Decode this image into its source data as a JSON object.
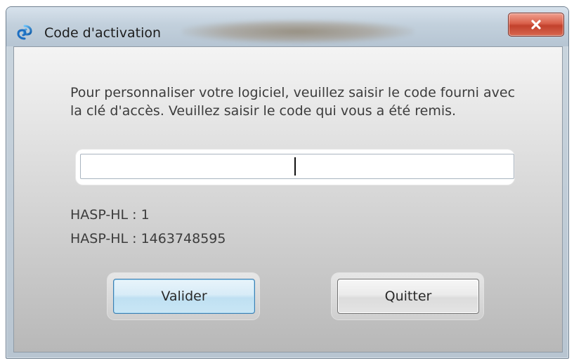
{
  "window": {
    "title": "Code d'activation",
    "close_label": "X"
  },
  "dialog": {
    "message": "Pour personnaliser votre logiciel, veuillez saisir le code fourni avec la clé d'accès. Veuillez saisir le code qui vous a été remis.",
    "code_input": {
      "value": "",
      "placeholder": ""
    },
    "hasp_lines": [
      "HASP-HL : 1",
      "HASP-HL : 1463748595"
    ]
  },
  "buttons": {
    "valider": "Valider",
    "quitter": "Quitter"
  },
  "icons": {
    "app": "app-swirl-icon",
    "close": "close-icon"
  },
  "colors": {
    "close_button": "#d9604a",
    "focused_button_border": "#3c7fb1",
    "text": "#3c3c3c"
  }
}
